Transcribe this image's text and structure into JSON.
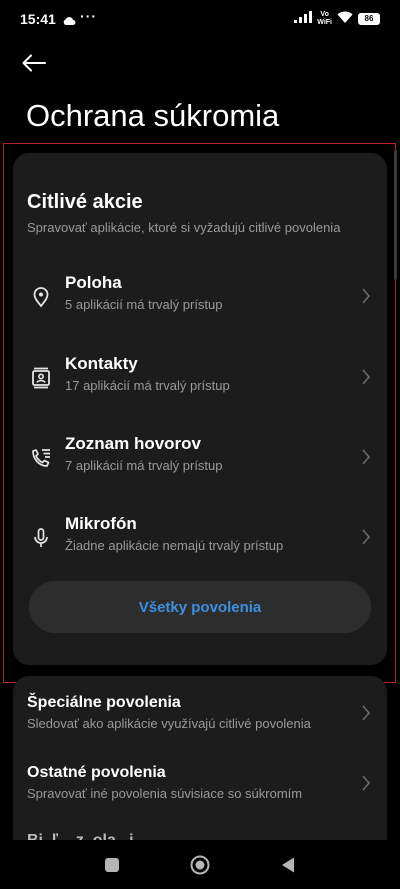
{
  "status_bar": {
    "time": "15:41",
    "dots": "···",
    "vo": "Vo",
    "wifi": "WiFi",
    "battery": "86"
  },
  "page": {
    "title": "Ochrana súkromia"
  },
  "sensitive": {
    "title": "Citlivé akcie",
    "subtitle": "Spravovať aplikácie, ktoré si vyžadujú citlivé povolenia",
    "items": [
      {
        "label": "Poloha",
        "desc": "5 aplikácií má trvalý prístup",
        "icon": "location-pin-icon"
      },
      {
        "label": "Kontakty",
        "desc": "17 aplikácií má trvalý prístup",
        "icon": "contacts-icon"
      },
      {
        "label": "Zoznam hovorov",
        "desc": "7 aplikácií má trvalý prístup",
        "icon": "call-log-icon"
      },
      {
        "label": "Mikrofón",
        "desc": "Žiadne aplikácie nemajú trvalý prístup",
        "icon": "microphone-icon"
      }
    ],
    "all_button": "Všetky povolenia"
  },
  "more": {
    "items": [
      {
        "label": "Špeciálne povolenia",
        "desc": "Sledovať ako aplikácie využívajú citlivé povolenia"
      },
      {
        "label": "Ostatné povolenia",
        "desc": "Spravovať iné povolenia súvisiace so súkromím"
      },
      {
        "label": "Bi, ľ... z..ola...i."
      }
    ]
  },
  "colors": {
    "accent": "#3d8fe0",
    "card": "#1c1c1c",
    "highlight": "#b3262e"
  }
}
